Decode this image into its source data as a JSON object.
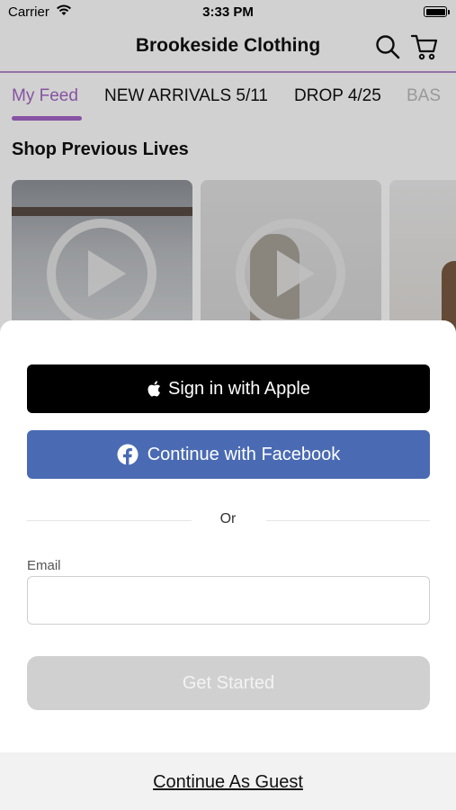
{
  "status_bar": {
    "carrier": "Carrier",
    "time": "3:33 PM"
  },
  "header": {
    "title": "Brookeside Clothing"
  },
  "tabs": [
    {
      "label": "My Feed",
      "active": true
    },
    {
      "label": "NEW ARRIVALS 5/11"
    },
    {
      "label": "DROP 4/25"
    },
    {
      "label": "BAS"
    }
  ],
  "feed": {
    "section_title": "Shop Previous Lives"
  },
  "sheet": {
    "apple_label": "Sign in with Apple",
    "facebook_label": "Continue with Facebook",
    "or_text": "Or",
    "email_label": "Email",
    "email_value": "",
    "email_placeholder": "",
    "get_started_label": "Get Started",
    "guest_label": "Continue As Guest"
  },
  "colors": {
    "accent": "#a566c6",
    "facebook": "#4a6bb3",
    "apple": "#000000",
    "disabled_button": "#d0d0d0"
  }
}
